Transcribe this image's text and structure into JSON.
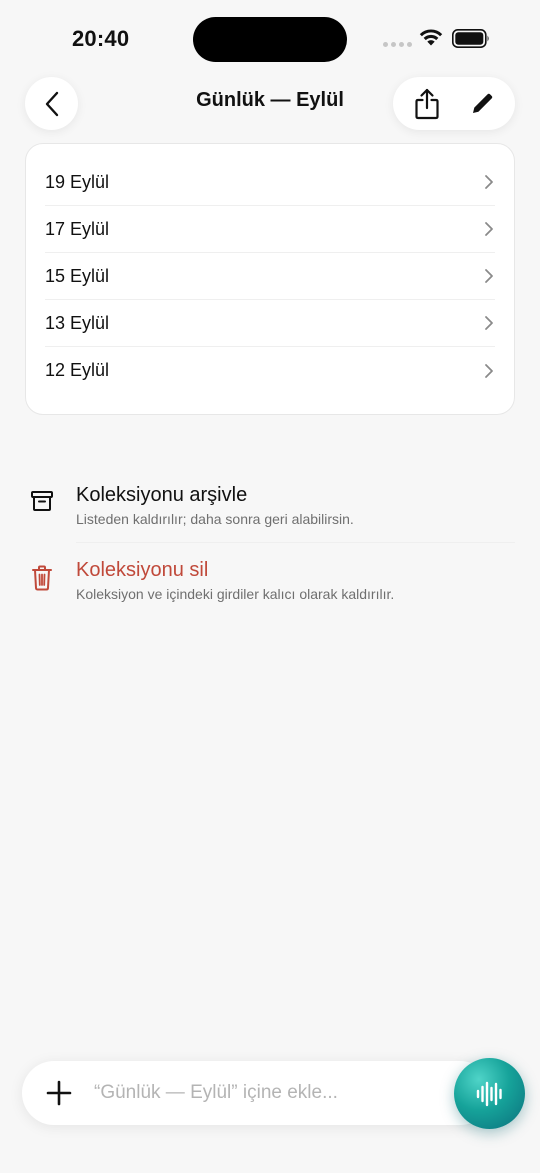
{
  "status_bar": {
    "time": "20:40"
  },
  "nav": {
    "title": "Günlük — Eylül"
  },
  "entries": [
    {
      "label": "19 Eylül"
    },
    {
      "label": "17 Eylül"
    },
    {
      "label": "15 Eylül"
    },
    {
      "label": "13 Eylül"
    },
    {
      "label": "12 Eylül"
    }
  ],
  "actions": {
    "archive": {
      "title": "Koleksiyonu arşivle",
      "subtitle": "Listeden kaldırılır; daha sonra geri alabilirsin.",
      "icon": "archive-icon"
    },
    "delete": {
      "title": "Koleksiyonu sil",
      "subtitle": "Koleksiyon ve içindeki girdiler kalıcı olarak kaldırılır.",
      "icon": "trash-icon",
      "color": "#c0493a"
    }
  },
  "composer": {
    "placeholder": "“Günlük — Eylül” içine ekle...",
    "value": ""
  },
  "colors": {
    "accent": "#16a39a",
    "danger": "#c0493a",
    "background": "#f7f7f7"
  }
}
